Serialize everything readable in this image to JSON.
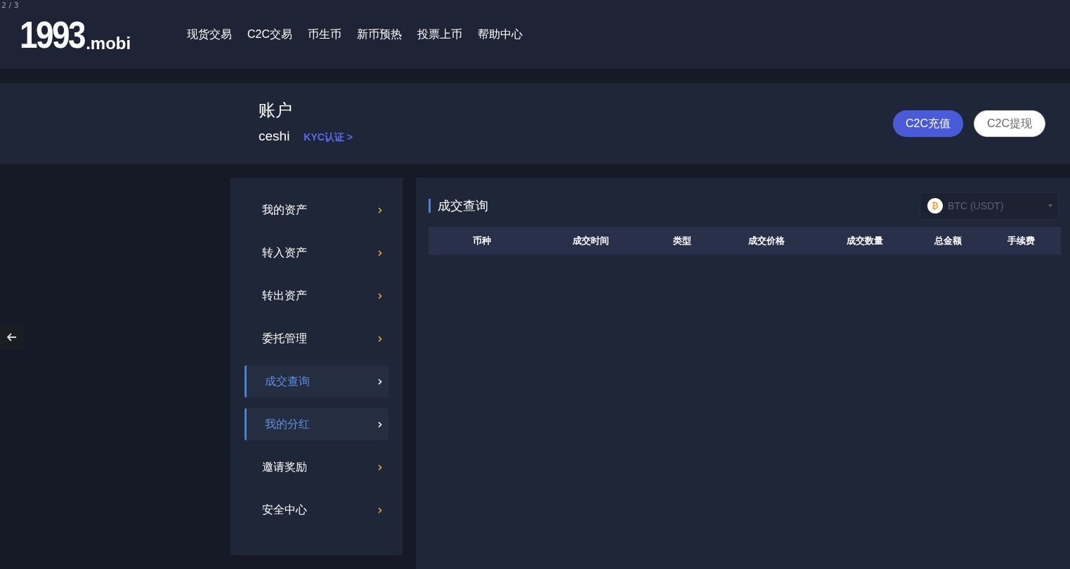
{
  "page_indicator": "2 / 3",
  "header": {
    "logo": {
      "main": "1993",
      "suffix": ".mobi"
    },
    "nav": [
      "现货交易",
      "C2C交易",
      "币生币",
      "新币预热",
      "投票上币",
      "帮助中心"
    ]
  },
  "account": {
    "title": "账户",
    "username": "ceshi",
    "kyc_link": "KYC认证 >",
    "buttons": [
      {
        "label": "C2C充值",
        "kind": "primary"
      },
      {
        "label": "C2C提现",
        "kind": "secondary"
      }
    ]
  },
  "sidebar": {
    "items": [
      {
        "label": "我的资产",
        "highlighted": false
      },
      {
        "label": "转入资产",
        "highlighted": false
      },
      {
        "label": "转出资产",
        "highlighted": false
      },
      {
        "label": "委托管理",
        "highlighted": false
      },
      {
        "label": "成交查询",
        "highlighted": true
      },
      {
        "label": "我的分红",
        "highlighted": true
      },
      {
        "label": "邀请奖励",
        "highlighted": false
      },
      {
        "label": "安全中心",
        "highlighted": false
      }
    ]
  },
  "main": {
    "title": "成交查询",
    "market_select": {
      "value": "BTC (USDT)",
      "coin_symbol": "₿"
    },
    "table": {
      "columns": [
        "币种",
        "成交时间",
        "类型",
        "成交价格",
        "成交数量",
        "总金额",
        "手续费"
      ]
    }
  }
}
